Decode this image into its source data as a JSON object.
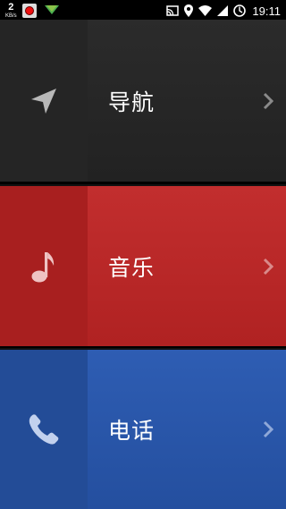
{
  "status_bar": {
    "speed_value": "2",
    "speed_unit": "KB/s",
    "time": "19:11"
  },
  "menu": [
    {
      "label": "导航",
      "icon": "navigation-arrow-icon",
      "color": "#2a2a2a"
    },
    {
      "label": "音乐",
      "icon": "music-note-icon",
      "color": "#be2b2b"
    },
    {
      "label": "电话",
      "icon": "phone-icon",
      "color": "#2d5bb0"
    }
  ]
}
